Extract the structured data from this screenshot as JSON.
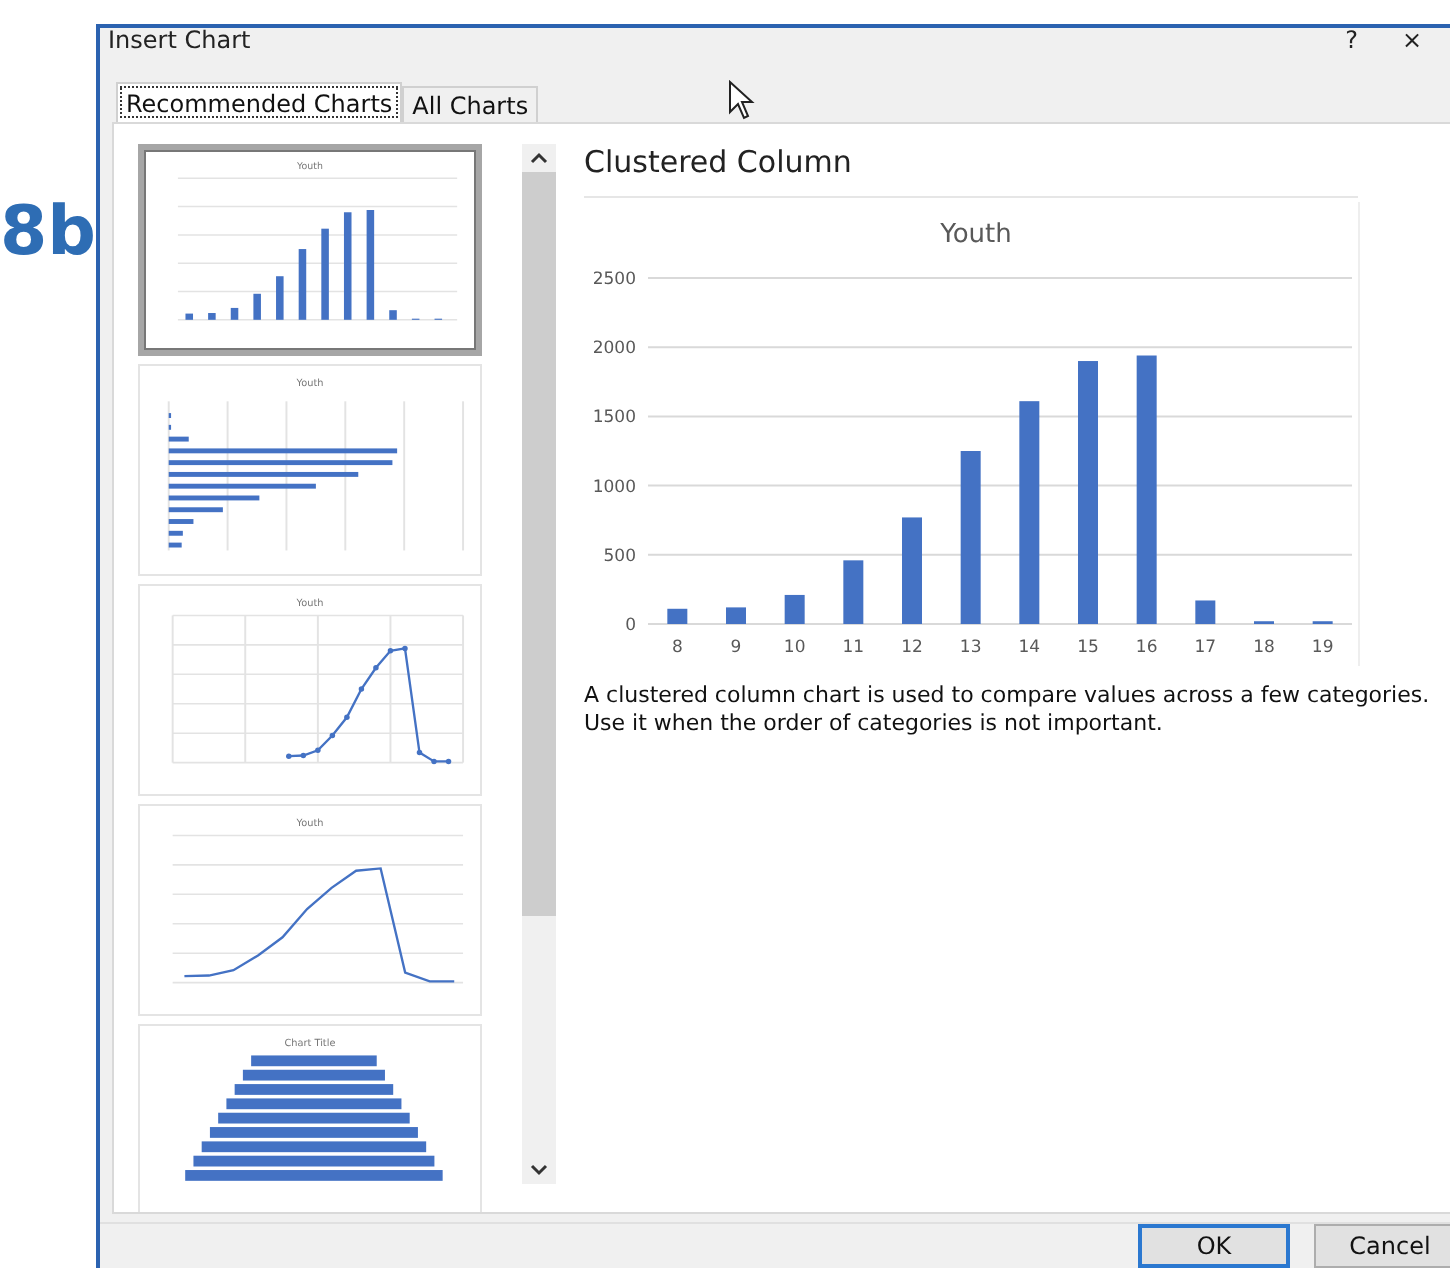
{
  "side_label": "8b",
  "window": {
    "title": "Insert Chart",
    "buttons": [
      "?",
      "×"
    ]
  },
  "tabs": [
    {
      "label": "Recommended Charts",
      "selected": true
    },
    {
      "label": "All Charts",
      "selected": false
    }
  ],
  "thumbnails": [
    {
      "kind": "column",
      "title": "Youth",
      "selected": true
    },
    {
      "kind": "bar",
      "title": "Youth",
      "selected": false
    },
    {
      "kind": "scatter",
      "title": "Youth",
      "selected": false
    },
    {
      "kind": "line",
      "title": "Youth",
      "selected": false
    },
    {
      "kind": "funnel",
      "title": "Chart Title",
      "selected": false
    }
  ],
  "preview": {
    "heading": "Clustered Column",
    "chart_data": {
      "type": "bar",
      "title": "Youth",
      "categories": [
        "8",
        "9",
        "10",
        "11",
        "12",
        "13",
        "14",
        "15",
        "16",
        "17",
        "18",
        "19"
      ],
      "series": [
        {
          "color": "#4472c4",
          "values": [
            110,
            120,
            210,
            460,
            770,
            1250,
            1610,
            1900,
            1940,
            170,
            20,
            20
          ]
        }
      ],
      "grid": true,
      "ylim": [
        0,
        2500
      ],
      "yticks": [
        0,
        500,
        1000,
        1500,
        2000,
        2500
      ]
    },
    "description": "A clustered column chart is used to compare values across a few categories. Use it when the order of categories is not important."
  },
  "buttons": [
    {
      "label": "OK",
      "default": true
    },
    {
      "label": "Cancel",
      "default": false
    }
  ]
}
